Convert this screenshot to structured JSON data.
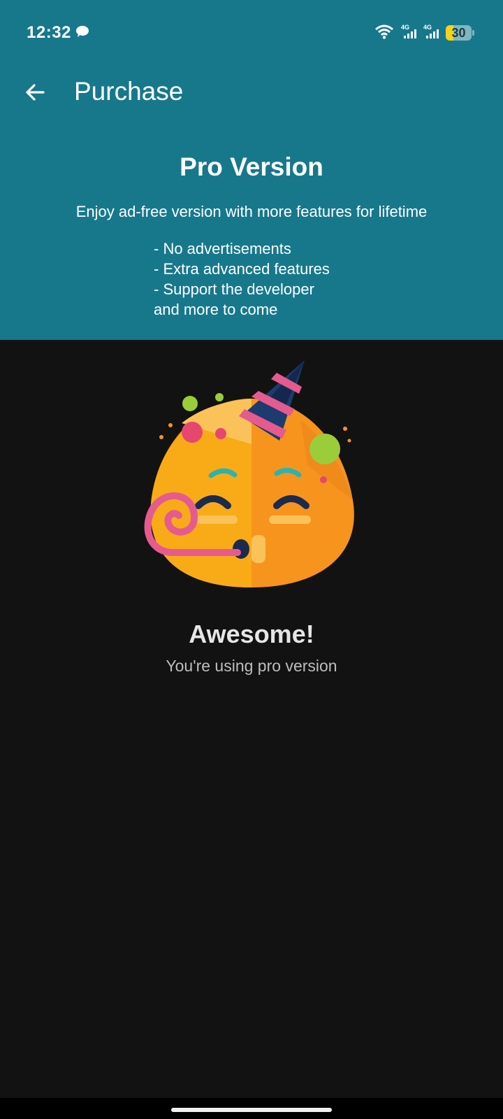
{
  "status_bar": {
    "time": "12:32",
    "battery_level": "30",
    "battery_fraction": 0.3,
    "network_label_1": "4G",
    "network_label_2": "4G",
    "icons": [
      "chat-bubble-icon",
      "wifi-icon",
      "signal-icon",
      "signal-icon",
      "battery-icon"
    ]
  },
  "app_bar": {
    "back_icon": "arrow-left-icon",
    "title": "Purchase"
  },
  "promo": {
    "title": "Pro Version",
    "subtitle": "Enjoy ad-free version with more features for lifetime",
    "features": [
      "- No advertisements",
      "- Extra advanced features",
      "- Support the developer",
      "and more to come"
    ]
  },
  "content": {
    "illustration": "party-emoji-icon",
    "headline": "Awesome!",
    "message": "You're using pro version"
  },
  "colors": {
    "header_bg": "#17788c",
    "body_bg": "#121212",
    "battery_fill": "#f6d21a"
  }
}
